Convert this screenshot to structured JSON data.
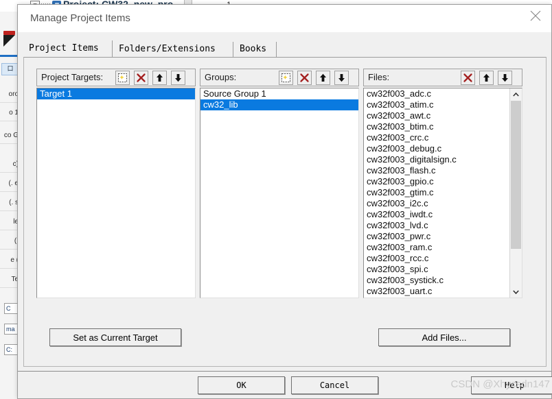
{
  "background": {
    "tree_expander": "−",
    "project_label": "Project: CW32_new_pro",
    "line_number": "1",
    "panel_chip": "口",
    "fragments": [
      "oro",
      "o 1",
      "co G",
      "c)",
      "(. e",
      "(. s",
      "le",
      "(.",
      "e (",
      "Te"
    ],
    "boxes": [
      "C",
      "ma",
      "C:"
    ]
  },
  "dialog": {
    "title": "Manage Project Items",
    "close_icon": "close-icon",
    "tabs": [
      {
        "label": "Project Items",
        "active": true
      },
      {
        "label": "Folders/Extensions",
        "active": false
      },
      {
        "label": "Books",
        "active": false
      }
    ],
    "columns": {
      "targets": {
        "label": "Project Targets:",
        "tools": [
          "new-item-icon",
          "delete-icon",
          "move-up-icon",
          "move-down-icon"
        ],
        "items": [
          {
            "label": "Target 1",
            "selected": true
          }
        ]
      },
      "groups": {
        "label": "Groups:",
        "tools": [
          "new-item-icon",
          "delete-icon",
          "move-up-icon",
          "move-down-icon"
        ],
        "items": [
          {
            "label": "Source Group 1",
            "selected": false
          },
          {
            "label": "cw32_lib",
            "selected": true
          }
        ]
      },
      "files": {
        "label": "Files:",
        "tools": [
          "delete-icon",
          "move-up-icon",
          "move-down-icon"
        ],
        "scroll_up_icon": "chevron-up-icon",
        "scroll_down_icon": "chevron-down-icon",
        "items": [
          {
            "label": "cw32f003_adc.c",
            "selected": false
          },
          {
            "label": "cw32f003_atim.c",
            "selected": false
          },
          {
            "label": "cw32f003_awt.c",
            "selected": false
          },
          {
            "label": "cw32f003_btim.c",
            "selected": false
          },
          {
            "label": "cw32f003_crc.c",
            "selected": false
          },
          {
            "label": "cw32f003_debug.c",
            "selected": false
          },
          {
            "label": "cw32f003_digitalsign.c",
            "selected": false
          },
          {
            "label": "cw32f003_flash.c",
            "selected": false
          },
          {
            "label": "cw32f003_gpio.c",
            "selected": false
          },
          {
            "label": "cw32f003_gtim.c",
            "selected": false
          },
          {
            "label": "cw32f003_i2c.c",
            "selected": false
          },
          {
            "label": "cw32f003_iwdt.c",
            "selected": false
          },
          {
            "label": "cw32f003_lvd.c",
            "selected": false
          },
          {
            "label": "cw32f003_pwr.c",
            "selected": false
          },
          {
            "label": "cw32f003_ram.c",
            "selected": false
          },
          {
            "label": "cw32f003_rcc.c",
            "selected": false
          },
          {
            "label": "cw32f003_spi.c",
            "selected": false
          },
          {
            "label": "cw32f003_systick.c",
            "selected": false
          },
          {
            "label": "cw32f003_uart.c",
            "selected": false
          }
        ]
      }
    },
    "actions": {
      "set_as_current_target": "Set as Current Target",
      "add_files": "Add Files..."
    },
    "footer": {
      "ok": "OK",
      "cancel": "Cancel",
      "help": "Help"
    }
  },
  "watermark": "CSDN @Xhycsdn147",
  "colors": {
    "selection_blue": "#0a7ae0",
    "delete_red": "#a31f1f",
    "dialog_face": "#f0f0f0",
    "title_text": "#555555"
  }
}
